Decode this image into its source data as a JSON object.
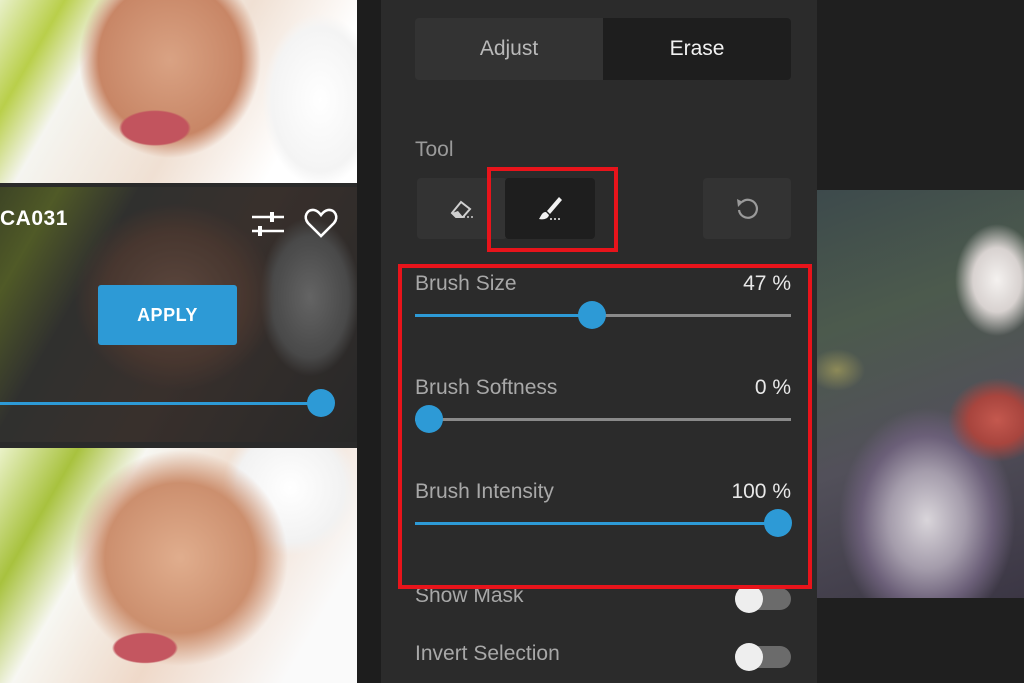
{
  "thumbnails": {
    "selected_style": "CA031",
    "apply_label": "APPLY",
    "strength_value": 1.0
  },
  "tabs": [
    {
      "label": "Adjust",
      "active": false
    },
    {
      "label": "Erase",
      "active": true
    }
  ],
  "tool": {
    "label": "Tool",
    "active_tool": "brush"
  },
  "sliders": [
    {
      "label": "Brush Size",
      "value": 47,
      "display": "47 %"
    },
    {
      "label": "Brush Softness",
      "value": 0,
      "display": "0 %"
    },
    {
      "label": "Brush Intensity",
      "value": 100,
      "display": "100 %"
    }
  ],
  "toggles": [
    {
      "label": "Show Mask",
      "on": false
    },
    {
      "label": "Invert Selection",
      "on": false
    }
  ],
  "colors": {
    "accent": "#2d9ad6",
    "highlight": "#e8141b",
    "panel": "#2b2b2b"
  },
  "icons": [
    "adjust-icon",
    "heart-icon",
    "eraser-icon",
    "brush-icon",
    "reset-icon"
  ]
}
